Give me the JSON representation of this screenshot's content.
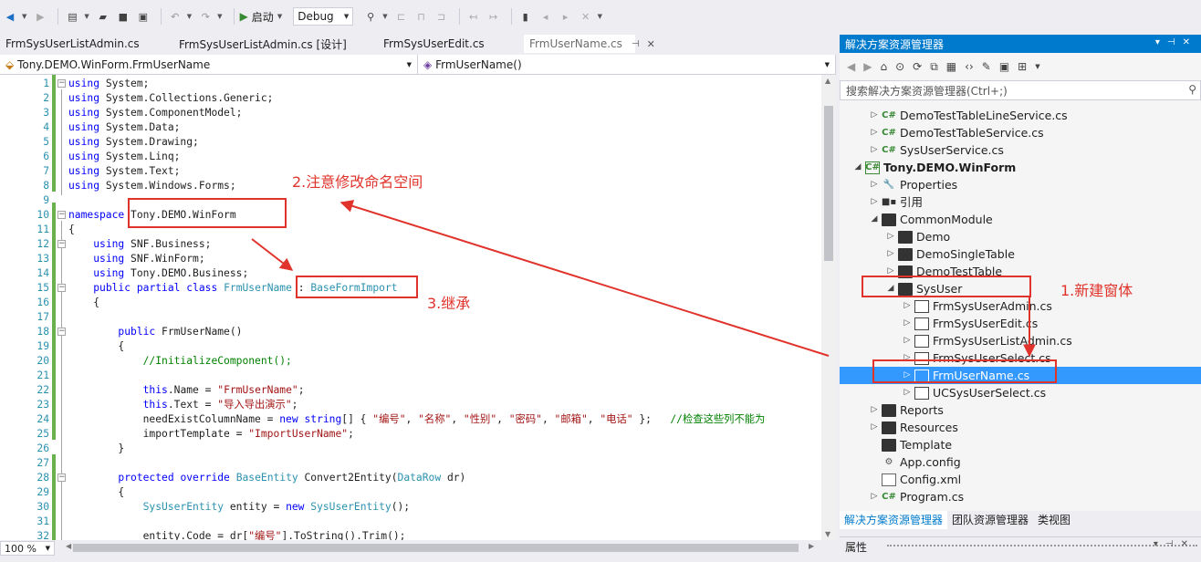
{
  "toolbar": {
    "start_label": "启动",
    "config_value": "Debug"
  },
  "tabs": [
    {
      "label": "FrmSysUserListAdmin.cs",
      "active": false
    },
    {
      "label": "FrmSysUserListAdmin.cs [设计]",
      "active": false
    },
    {
      "label": "FrmSysUserEdit.cs",
      "active": false
    },
    {
      "label": "FrmUserName.cs",
      "active": true
    }
  ],
  "navbar": {
    "type_combo": "Tony.DEMO.WinForm.FrmUserName",
    "member_combo": "FrmUserName()"
  },
  "code": [
    {
      "n": "1",
      "html": "<span class='kw'>using</span> System;"
    },
    {
      "n": "2",
      "html": "<span class='kw'>using</span> System.Collections.Generic;"
    },
    {
      "n": "3",
      "html": "<span class='kw'>using</span> System.ComponentModel;"
    },
    {
      "n": "4",
      "html": "<span class='kw'>using</span> System.Data;"
    },
    {
      "n": "5",
      "html": "<span class='kw'>using</span> System.Drawing;"
    },
    {
      "n": "6",
      "html": "<span class='kw'>using</span> System.Linq;"
    },
    {
      "n": "7",
      "html": "<span class='kw'>using</span> System.Text;"
    },
    {
      "n": "8",
      "html": "<span class='kw'>using</span> System.Windows.Forms;"
    },
    {
      "n": "9",
      "html": ""
    },
    {
      "n": "10",
      "html": "<span class='kw'>namespace</span> Tony.DEMO.WinForm"
    },
    {
      "n": "11",
      "html": "{"
    },
    {
      "n": "12",
      "html": "    <span class='kw'>using</span> SNF.Business;"
    },
    {
      "n": "13",
      "html": "    <span class='kw'>using</span> SNF.WinForm;"
    },
    {
      "n": "14",
      "html": "    <span class='kw'>using</span> Tony.DEMO.Business;"
    },
    {
      "n": "15",
      "html": "    <span class='kw'>public</span> <span class='kw'>partial</span> <span class='kw'>class</span> <span class='ty'>FrmUserName</span> : <span class='ty'>BaseFormImport</span>"
    },
    {
      "n": "16",
      "html": "    {"
    },
    {
      "n": "17",
      "html": ""
    },
    {
      "n": "18",
      "html": "        <span class='kw'>public</span> FrmUserName()"
    },
    {
      "n": "19",
      "html": "        {"
    },
    {
      "n": "20",
      "html": "            <span class='cm'>//InitializeComponent();</span>"
    },
    {
      "n": "21",
      "html": ""
    },
    {
      "n": "22",
      "html": "            <span class='kw'>this</span>.Name = <span class='str'>\"FrmUserName\"</span>;"
    },
    {
      "n": "23",
      "html": "            <span class='kw'>this</span>.Text = <span class='str'>\"导入导出演示\"</span>;"
    },
    {
      "n": "24",
      "html": "            needExistColumnName = <span class='kw'>new</span> <span class='kw'>string</span>[] { <span class='str'>\"编号\"</span>, <span class='str'>\"名称\"</span>, <span class='str'>\"性别\"</span>, <span class='str'>\"密码\"</span>, <span class='str'>\"邮箱\"</span>, <span class='str'>\"电话\"</span> };   <span class='cm'>//检查这些列不能为</span>"
    },
    {
      "n": "25",
      "html": "            importTemplate = <span class='str'>\"ImportUserName\"</span>;"
    },
    {
      "n": "26",
      "html": "        }"
    },
    {
      "n": "27",
      "html": ""
    },
    {
      "n": "28",
      "html": "        <span class='kw'>protected</span> <span class='kw'>override</span> <span class='ty'>BaseEntity</span> Convert2Entity(<span class='ty'>DataRow</span> dr)"
    },
    {
      "n": "29",
      "html": "        {"
    },
    {
      "n": "30",
      "html": "            <span class='ty'>SysUserEntity</span> entity = <span class='kw'>new</span> <span class='ty'>SysUserEntity</span>();"
    },
    {
      "n": "31",
      "html": ""
    },
    {
      "n": "32",
      "html": "            entity.Code = dr[<span class='str'>\"编号\"</span>].ToString().Trim();"
    }
  ],
  "zoom": "100 %",
  "solution_explorer": {
    "title": "解决方案资源管理器",
    "search_placeholder": "搜索解决方案资源管理器(Ctrl+;)",
    "nodes": [
      {
        "label": "DemoTestTableLineService.cs",
        "icon": "csharp-file-icon",
        "exp": "▷",
        "indent": 1
      },
      {
        "label": "DemoTestTableService.cs",
        "icon": "csharp-file-icon",
        "exp": "▷",
        "indent": 1
      },
      {
        "label": "SysUserService.cs",
        "icon": "csharp-file-icon",
        "exp": "▷",
        "indent": 1
      },
      {
        "label": "Tony.DEMO.WinForm",
        "icon": "csharp-project-icon",
        "exp": "◢",
        "indent": 0,
        "bold": true
      },
      {
        "label": "Properties",
        "icon": "wrench-icon",
        "exp": "▷",
        "indent": 1
      },
      {
        "label": "引用",
        "icon": "reference-icon",
        "exp": "▷",
        "indent": 1
      },
      {
        "label": "CommonModule",
        "icon": "folder-icon",
        "exp": "◢",
        "indent": 1
      },
      {
        "label": "Demo",
        "icon": "folder-icon",
        "exp": "▷",
        "indent": 2
      },
      {
        "label": "DemoSingleTable",
        "icon": "folder-icon",
        "exp": "▷",
        "indent": 2
      },
      {
        "label": "DemoTestTable",
        "icon": "folder-icon",
        "exp": "▷",
        "indent": 2
      },
      {
        "label": "SysUser",
        "icon": "folder-icon",
        "exp": "◢",
        "indent": 2
      },
      {
        "label": "FrmSysUserAdmin.cs",
        "icon": "form-icon",
        "exp": "▷",
        "indent": 3
      },
      {
        "label": "FrmSysUserEdit.cs",
        "icon": "form-icon",
        "exp": "▷",
        "indent": 3
      },
      {
        "label": "FrmSysUserListAdmin.cs",
        "icon": "form-icon",
        "exp": "▷",
        "indent": 3
      },
      {
        "label": "FrmSysUserSelect.cs",
        "icon": "form-icon",
        "exp": "▷",
        "indent": 3
      },
      {
        "label": "FrmUserName.cs",
        "icon": "form-icon",
        "exp": "▷",
        "indent": 3,
        "selected": true
      },
      {
        "label": "UCSysUserSelect.cs",
        "icon": "user-control-icon",
        "exp": "▷",
        "indent": 3
      },
      {
        "label": "Reports",
        "icon": "folder-icon",
        "exp": "▷",
        "indent": 1
      },
      {
        "label": "Resources",
        "icon": "folder-icon",
        "exp": "▷",
        "indent": 1
      },
      {
        "label": "Template",
        "icon": "folder-icon",
        "exp": "",
        "indent": 1
      },
      {
        "label": "App.config",
        "icon": "config-file-icon",
        "exp": "",
        "indent": 1
      },
      {
        "label": "Config.xml",
        "icon": "xml-file-icon",
        "exp": "",
        "indent": 1
      },
      {
        "label": "Program.cs",
        "icon": "csharp-file-icon",
        "exp": "▷",
        "indent": 1
      }
    ],
    "bottom_tabs": [
      "解决方案资源管理器",
      "团队资源管理器",
      "类视图"
    ]
  },
  "properties_panel": {
    "title": "属性"
  },
  "annotations": [
    {
      "text": "2.注意修改命名空间"
    },
    {
      "text": "3.继承"
    },
    {
      "text": "1.新建窗体"
    }
  ],
  "colors": {
    "accent": "#007acc",
    "selection": "#3399ff",
    "annotation": "#e0332b",
    "keyword": "#0000ff",
    "type": "#2b91af",
    "string": "#a31515",
    "comment": "#008000"
  }
}
